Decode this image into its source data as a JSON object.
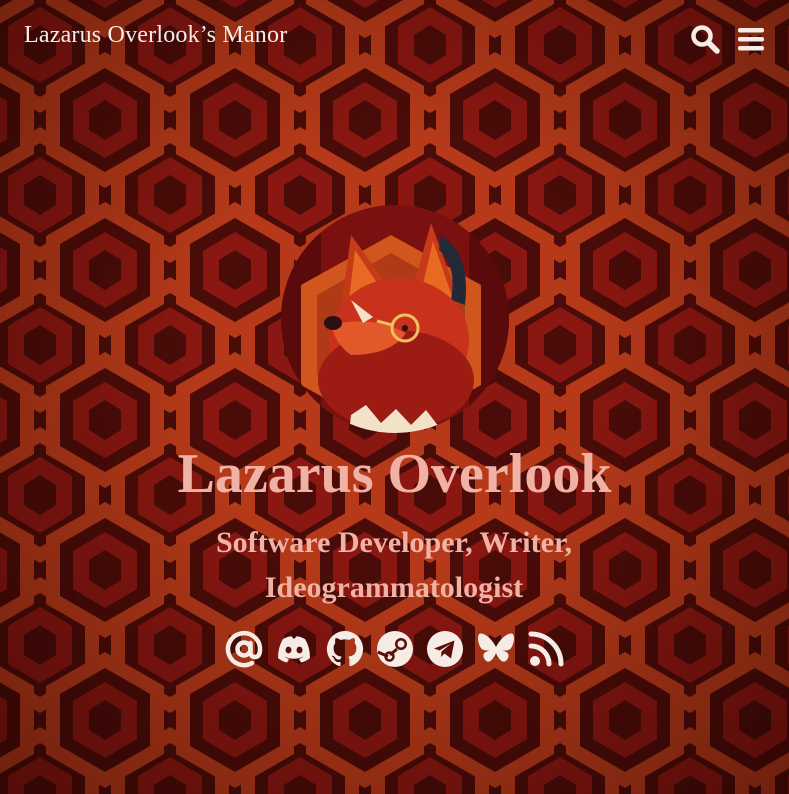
{
  "header": {
    "site_title": "Lazarus Overlook’s Manor",
    "search_icon": "search-icon",
    "menu_icon": "hamburger-menu-icon"
  },
  "profile": {
    "avatar": "red-fox-character-avatar",
    "name": "Lazarus Overlook",
    "tagline": "Software Developer, Writer, Ideogrammatologist"
  },
  "socials": [
    {
      "icon": "at-sign-icon",
      "service": "email"
    },
    {
      "icon": "discord-icon",
      "service": "discord"
    },
    {
      "icon": "github-icon",
      "service": "github"
    },
    {
      "icon": "steam-icon",
      "service": "steam"
    },
    {
      "icon": "telegram-icon",
      "service": "telegram"
    },
    {
      "icon": "bluesky-butterfly-icon",
      "service": "bluesky"
    },
    {
      "icon": "rss-icon",
      "service": "rss"
    }
  ],
  "colors": {
    "background_dark": "#4a0c08",
    "pattern_orange": "#c2401b",
    "pattern_red": "#8a1711",
    "heading_pink": "#f1b2a6",
    "title_text": "#f6ece6",
    "icon_cream": "#f6ece6"
  }
}
